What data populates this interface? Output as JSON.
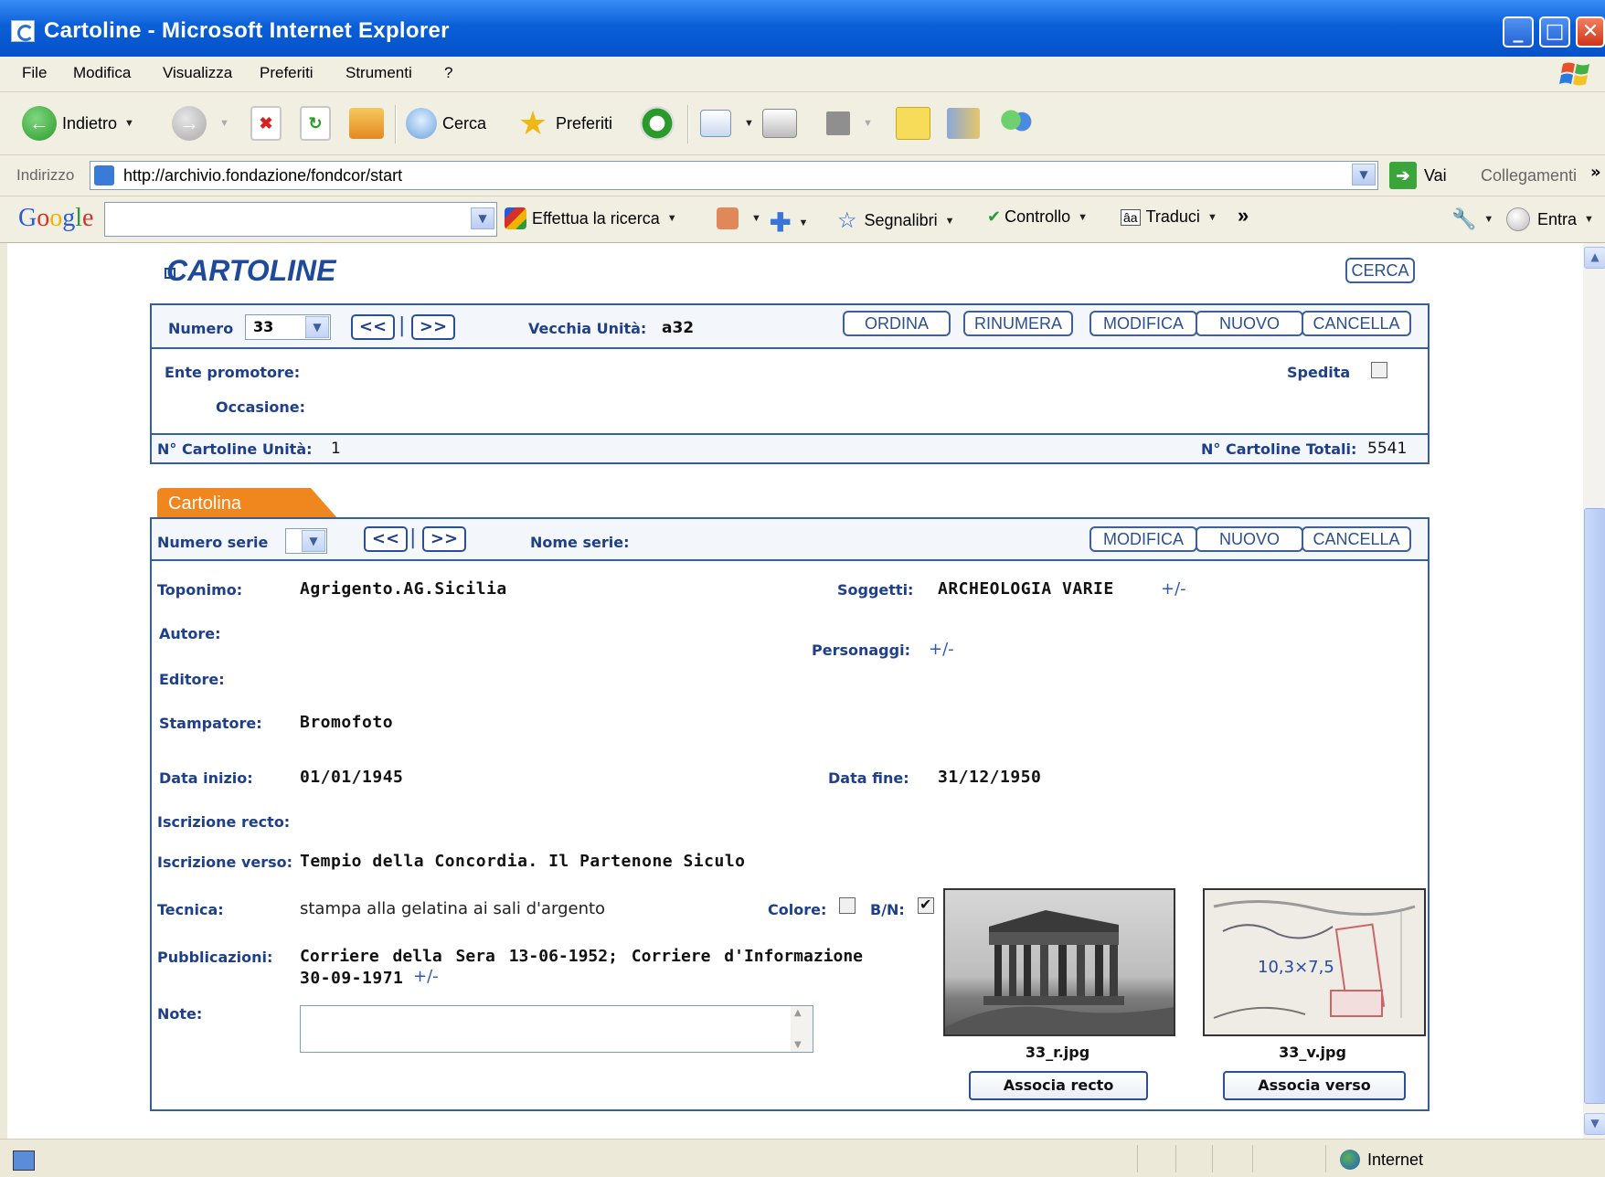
{
  "window": {
    "title": "Cartoline - Microsoft Internet Explorer"
  },
  "menu": [
    "File",
    "Modifica",
    "Visualizza",
    "Preferiti",
    "Strumenti",
    "?"
  ],
  "toolbar": {
    "back": "Indietro",
    "search": "Cerca",
    "favorites": "Preferiti"
  },
  "address": {
    "label": "Indirizzo",
    "url": "http://archivio.fondazione/fondcor/start",
    "go": "Vai",
    "links": "Collegamenti"
  },
  "google": {
    "logo": "Google",
    "search_btn": "Effettua la ricerca",
    "bookmarks": "Segnalibri",
    "spell": "Controllo",
    "translate": "Traduci",
    "more": "»",
    "signin": "Entra"
  },
  "status": {
    "zone": "Internet"
  },
  "page": {
    "title": "CARTOLINE",
    "search_btn": "CERCA",
    "unit": {
      "numero_label": "Numero",
      "numero_value": "33",
      "prev": "<<",
      "next": ">>",
      "vecchia_label": "Vecchia Unità:",
      "vecchia_value": "a32",
      "buttons": {
        "ordina": "ORDINA",
        "rinumera": "RINUMERA",
        "modifica": "MODIFICA",
        "nuovo": "NUOVO",
        "cancella": "CANCELLA"
      },
      "ente_label": "Ente promotore:",
      "spedita_label": "Spedita",
      "occasione_label": "Occasione:",
      "n_unita_label": "N° Cartoline Unità:",
      "n_unita_value": "1",
      "n_totali_label": "N° Cartoline Totali:",
      "n_totali_value": "5541"
    },
    "card": {
      "tab": "Cartolina",
      "numero_serie_label": "Numero serie",
      "prev": "<<",
      "next": ">>",
      "nome_serie_label": "Nome serie:",
      "buttons": {
        "modifica": "MODIFICA",
        "nuovo": "NUOVO",
        "cancella": "CANCELLA"
      },
      "toponimo_label": "Toponimo:",
      "toponimo_value": "Agrigento.AG.Sicilia",
      "soggetti_label": "Soggetti:",
      "soggetti_value": "ARCHEOLOGIA VARIE",
      "plusminus": "+/-",
      "autore_label": "Autore:",
      "personaggi_label": "Personaggi:",
      "editore_label": "Editore:",
      "stampatore_label": "Stampatore:",
      "stampatore_value": "Bromofoto",
      "data_inizio_label": "Data inizio:",
      "data_inizio_value": "01/01/1945",
      "data_fine_label": "Data fine:",
      "data_fine_value": "31/12/1950",
      "iscr_recto_label": "Iscrizione recto:",
      "iscr_verso_label": "Iscrizione verso:",
      "iscr_verso_value": "Tempio della Concordia. Il Partenone Siculo",
      "tecnica_label": "Tecnica:",
      "tecnica_value": "stampa alla gelatina ai sali d'argento",
      "colore_label": "Colore:",
      "bn_label": "B/N:",
      "pubbl_label": "Pubblicazioni:",
      "pubbl_line1": "Corriere della Sera 13-06-1952; Corriere d'Informazione",
      "pubbl_line2": "30-09-1971",
      "note_label": "Note:",
      "recto_file": "33_r.jpg",
      "verso_file": "33_v.jpg",
      "assoc_recto": "Associa recto",
      "assoc_verso": "Associa verso",
      "verso_handwriting": "10,3×7,5"
    }
  }
}
